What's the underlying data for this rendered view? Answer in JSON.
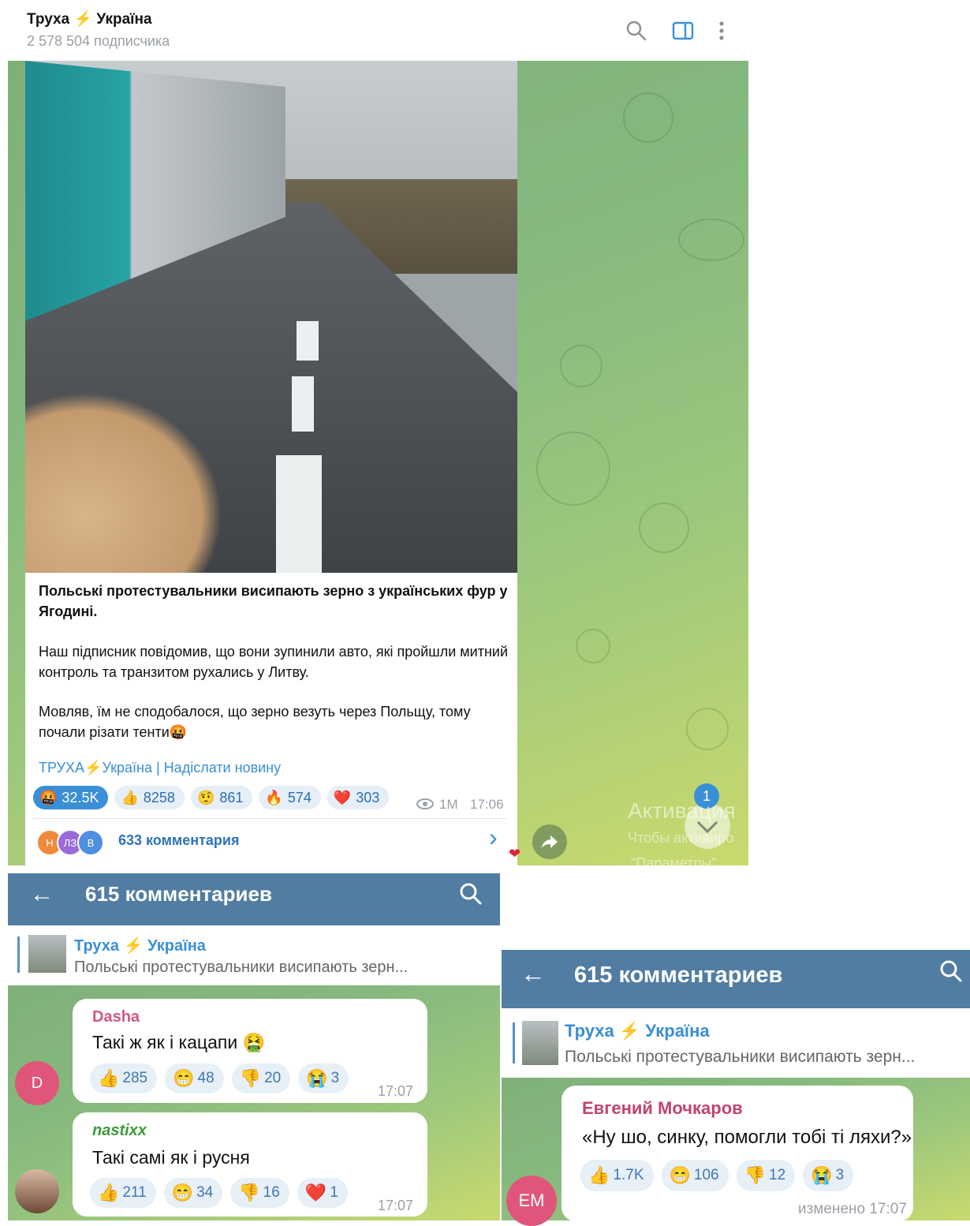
{
  "channel": {
    "name_part1": "Труха",
    "bolt": "⚡",
    "name_part2": "Україна",
    "subscribers": "2 578 504 подписчика"
  },
  "header_icons": [
    "search-icon",
    "sidebar-toggle-icon",
    "more-vertical-icon"
  ],
  "post": {
    "caption_bold": "Польські протестувальники висипають зерно з українських фур у Ягодині.",
    "paragraph1": "Наш підписник повідомив, що вони зупинили авто, які пройшли митний контроль та транзитом рухались у Литву.",
    "paragraph2": "Мовляв, їм не сподобалося, що зерно везуть через Польщу, тому почали різати тенти🤬",
    "link_channel_a": "ТРУХА",
    "link_channel_b": "Україна",
    "link_separator": "|",
    "link_send": "Надіслати новину",
    "reactions": [
      {
        "emoji": "🤬",
        "count": "32.5K",
        "active": true
      },
      {
        "emoji": "👍",
        "count": "8258"
      },
      {
        "emoji": "🤨",
        "count": "861"
      },
      {
        "emoji": "🔥",
        "count": "574"
      },
      {
        "emoji": "❤️",
        "count": "303"
      }
    ],
    "views": "1M",
    "time": "17:06",
    "commenter_avatars": [
      "Н",
      "ЛЗ",
      "В"
    ],
    "comments_label": "633 комментария",
    "comments_arrow": "›"
  },
  "overlay": {
    "unread_badge": "1",
    "activation_title": "Активация",
    "activation_line1": "Чтобы активиро",
    "activation_line2": "\"Параметры\"."
  },
  "left_panel": {
    "back": "←",
    "title": "615 комментариев",
    "pinned_name_a": "Труха",
    "pinned_name_b": "Україна",
    "pinned_text": "Польські протестувальники висипають зерн...",
    "comments": [
      {
        "author": "Dasha",
        "avatar": "D",
        "text": "Такі ж як і кацапи 🤮",
        "reactions": [
          {
            "emoji": "👍",
            "count": "285"
          },
          {
            "emoji": "😁",
            "count": "48"
          },
          {
            "emoji": "👎",
            "count": "20"
          },
          {
            "emoji": "😭",
            "count": "3"
          }
        ],
        "time": "17:07"
      },
      {
        "author": "nastixx",
        "avatar": "",
        "text": "Такі самі як і русня",
        "reactions": [
          {
            "emoji": "👍",
            "count": "211"
          },
          {
            "emoji": "😁",
            "count": "34"
          },
          {
            "emoji": "👎",
            "count": "16"
          },
          {
            "emoji": "❤️",
            "count": "1"
          }
        ],
        "time": "17:07"
      }
    ]
  },
  "right_panel": {
    "back": "←",
    "title": "615 комментариев",
    "pinned_name_a": "Труха",
    "pinned_name_b": "Україна",
    "pinned_text": "Польські протестувальники висипають зерн...",
    "comment": {
      "author": "Евгений Мочкаров",
      "avatar": "ЕМ",
      "text": "«Ну шо, синку, помогли тобі ті ляхи?»",
      "reactions": [
        {
          "emoji": "👍",
          "count": "1.7K"
        },
        {
          "emoji": "😁",
          "count": "106"
        },
        {
          "emoji": "👎",
          "count": "12"
        },
        {
          "emoji": "😭",
          "count": "3"
        }
      ],
      "edited": "изменено 17:07"
    }
  },
  "colors": {
    "appbar": "#517da2",
    "link": "#3a8fd6",
    "active_reaction": "#3a8fd6",
    "accent_bolt": "#f7c33a"
  }
}
